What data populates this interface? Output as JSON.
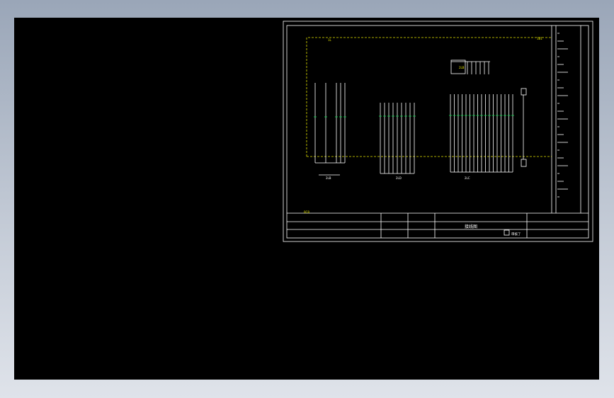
{
  "drawing": {
    "title_block": {
      "title": "接线图",
      "designer_note": "审核了"
    },
    "labels": {
      "left_group_main": "2LB",
      "center_group_main": "2LD",
      "right_group_main": "2LC",
      "corner_tag": "0C8",
      "top_left_tag": "1L",
      "top_right_tag": "1B1",
      "relay_tag": "2LB"
    },
    "colors": {
      "background": "#000000",
      "frame": "#ffffff",
      "boundary": "#e6e600",
      "terminal": "#00e04a"
    }
  }
}
